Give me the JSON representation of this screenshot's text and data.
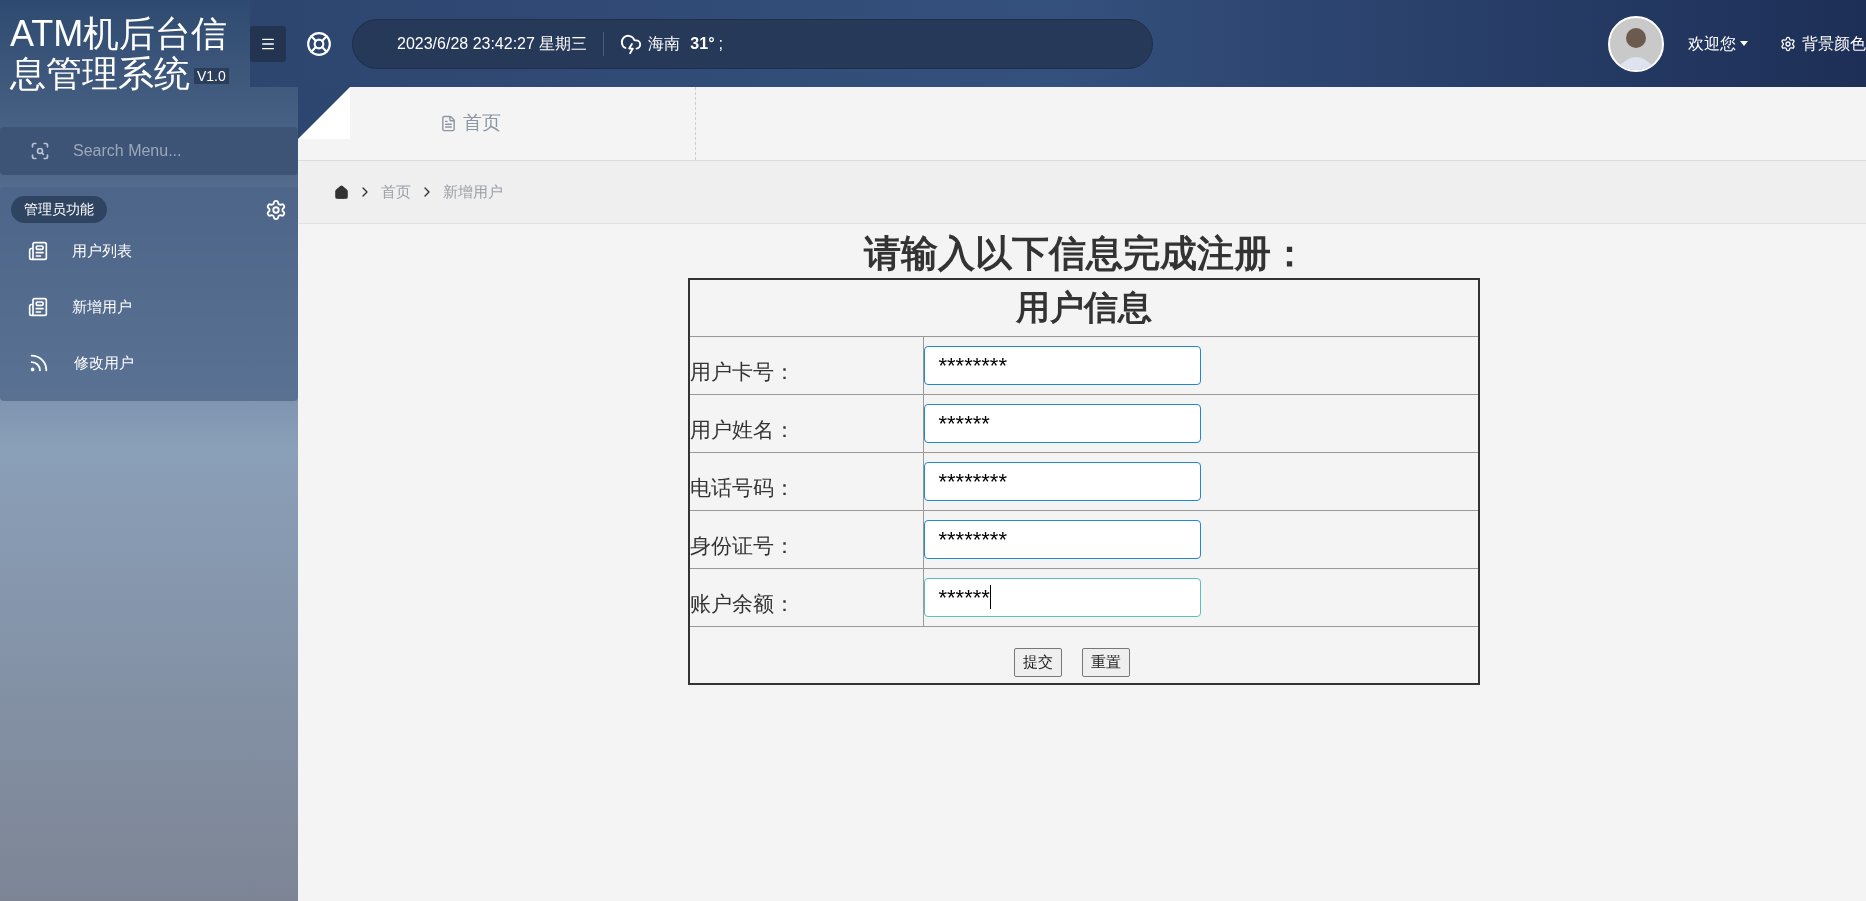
{
  "app": {
    "title": "ATM机后台信息管理系统",
    "version": "V1.0"
  },
  "header": {
    "datetime": "2023/6/28 23:42:27 星期三",
    "city": "海南",
    "temperature": "31°",
    "temp_suffix": ";",
    "welcome": "欢迎您",
    "background_color": "背景颜色"
  },
  "sidebar": {
    "search": {
      "placeholder": "Search Menu..."
    },
    "section": "管理员功能",
    "items": [
      {
        "label": "用户列表",
        "kind": "doc",
        "selected": false
      },
      {
        "label": "新增用户",
        "kind": "doc",
        "selected": false
      },
      {
        "label": "修改用户",
        "kind": "feed",
        "selected": false
      }
    ]
  },
  "tabs": [
    {
      "label": "首页",
      "selected": false
    }
  ],
  "breadcrumb": [
    "首页",
    "新增用户"
  ],
  "form": {
    "heading": "请输入以下信息完成注册：",
    "table_title": "用户信息",
    "fields": [
      {
        "label": "用户卡号：",
        "value": "********",
        "focused": false
      },
      {
        "label": "用户姓名：",
        "value": "******",
        "focused": false
      },
      {
        "label": "电话号码：",
        "value": "********",
        "focused": false
      },
      {
        "label": "身份证号：",
        "value": "********",
        "focused": false
      },
      {
        "label": "账户余额：",
        "value": "******",
        "focused": true
      }
    ],
    "buttons": [
      "提交",
      "重置"
    ]
  }
}
